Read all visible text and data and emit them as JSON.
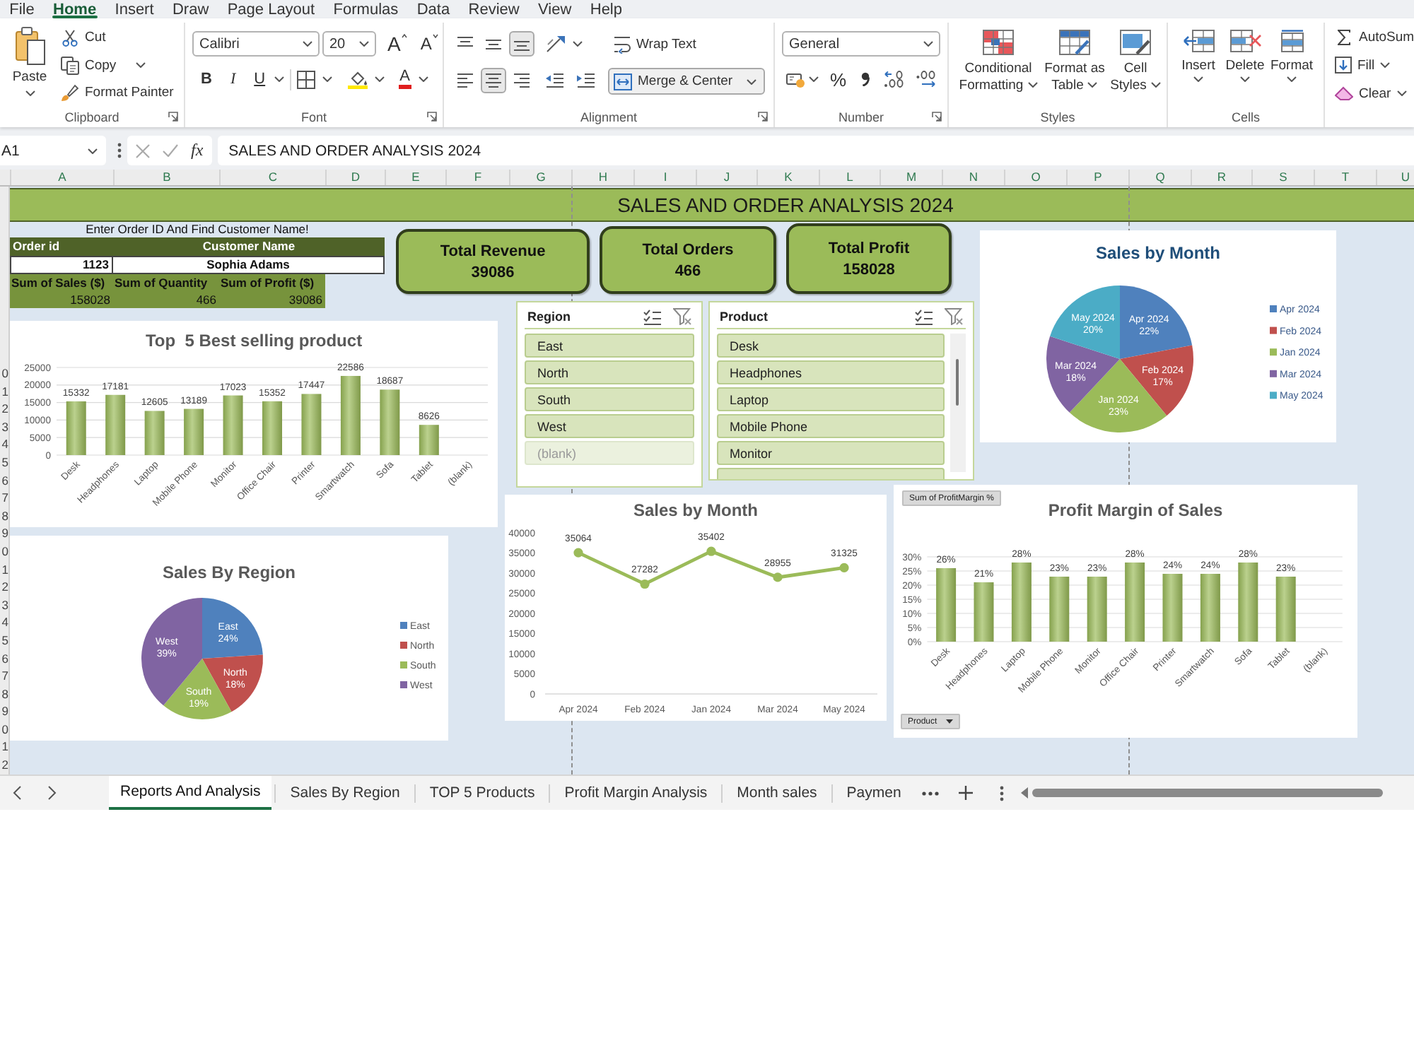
{
  "menu_tabs": [
    {
      "label": "File",
      "selected": false
    },
    {
      "label": "Home",
      "selected": true
    },
    {
      "label": "Insert",
      "selected": false
    },
    {
      "label": "Draw",
      "selected": false
    },
    {
      "label": "Page Layout",
      "selected": false
    },
    {
      "label": "Formulas",
      "selected": false
    },
    {
      "label": "Data",
      "selected": false
    },
    {
      "label": "Review",
      "selected": false
    },
    {
      "label": "View",
      "selected": false
    },
    {
      "label": "Help",
      "selected": false
    }
  ],
  "ribbon": {
    "clipboard": {
      "label": "Clipboard",
      "paste": "Paste",
      "cut": "Cut",
      "copy": "Copy",
      "format_painter": "Format Painter"
    },
    "font": {
      "label": "Font",
      "font_name": "Calibri",
      "font_size": "20",
      "grow": "A",
      "shrink": "A",
      "bold": "B",
      "italic": "I",
      "underline": "U",
      "font_color": "A"
    },
    "alignment": {
      "label": "Alignment",
      "vertical_align": [
        {
          "selected": false
        },
        {
          "selected": false
        },
        {
          "selected": true
        }
      ],
      "horizontal_align": [
        {
          "selected": false
        },
        {
          "selected": true
        },
        {
          "selected": false
        }
      ],
      "wrap_text": {
        "label": "Wrap Text",
        "selected": false
      },
      "merge_center": {
        "label": "Merge & Center",
        "selected": true
      }
    },
    "number": {
      "label": "Number",
      "format": "General",
      "percent": "%"
    },
    "styles": {
      "label": "Styles",
      "buttons": [
        "Conditional Formatting",
        "Format as Table",
        "Cell Styles"
      ]
    },
    "cells": {
      "label": "Cells",
      "buttons": [
        "Insert",
        "Delete",
        "Format"
      ]
    },
    "editing": {
      "buttons": [
        "AutoSum",
        "Fill",
        "Clear"
      ]
    }
  },
  "formula_bar": {
    "name_box": "A1",
    "function_label": "fx",
    "formula": "SALES AND ORDER ANALYSIS 2024"
  },
  "sheet": {
    "columns": [
      "A",
      "B",
      "C",
      "D",
      "E",
      "F",
      "G",
      "H",
      "I",
      "J",
      "K",
      "L",
      "M",
      "N",
      "O",
      "P",
      "Q",
      "R",
      "S",
      "T",
      "U"
    ],
    "row_numbers": [
      "0",
      "1",
      "2",
      "3",
      "4",
      "5",
      "6",
      "7",
      "8",
      "9",
      "0",
      "1",
      "2",
      "3",
      "4",
      "5",
      "6",
      "7",
      "8",
      "9",
      "0",
      "1",
      "2"
    ],
    "title": "SALES AND ORDER ANALYSIS 2024",
    "lookup": {
      "prompt": "Enter Order ID And Find Customer Name!",
      "order_id_header": "Order id",
      "customer_header": "Customer Name",
      "order_id": "1123",
      "customer_name": "Sophia Adams",
      "summary": [
        {
          "header": "Sum of Sales ($)",
          "value": "158028"
        },
        {
          "header": "Sum of Quantity",
          "value": "466"
        },
        {
          "header": "Sum of Profit ($)",
          "value": "39086"
        }
      ]
    },
    "kpis": [
      {
        "label": "Total Revenue",
        "value": "39086"
      },
      {
        "label": "Total Orders",
        "value": "466"
      },
      {
        "label": "Total Profit",
        "value": "158028"
      }
    ],
    "slicers": [
      {
        "title": "Region",
        "items": [
          {
            "label": "East",
            "selected": true,
            "disabled": false
          },
          {
            "label": "North",
            "selected": true,
            "disabled": false
          },
          {
            "label": "South",
            "selected": true,
            "disabled": false
          },
          {
            "label": "West",
            "selected": true,
            "disabled": false
          },
          {
            "label": "(blank)",
            "selected": true,
            "disabled": true
          }
        ]
      },
      {
        "title": "Product",
        "items": [
          {
            "label": "Desk",
            "selected": true,
            "disabled": false
          },
          {
            "label": "Headphones",
            "selected": true,
            "disabled": false
          },
          {
            "label": "Laptop",
            "selected": true,
            "disabled": false
          },
          {
            "label": "Mobile Phone",
            "selected": true,
            "disabled": false
          },
          {
            "label": "Monitor",
            "selected": true,
            "disabled": false
          }
        ]
      }
    ],
    "charts": [
      {
        "chart_data": {
          "type": "pie",
          "title": "Sales by Month",
          "categories": [
            "Apr 2024",
            "Feb 2024",
            "Jan 2024",
            "Mar 2024",
            "May 2024"
          ],
          "values": [
            22,
            17,
            23,
            18,
            20
          ],
          "value_labels": [
            "22%",
            "17%",
            "23%",
            "18%",
            "20%"
          ],
          "colors": [
            "#4f81bd",
            "#c0504d",
            "#9bbb59",
            "#8064a2",
            "#4bacc6"
          ],
          "legend": "right"
        }
      },
      {
        "chart_data": {
          "type": "bar",
          "title": "Top  5 Best selling product",
          "categories": [
            "Desk",
            "Headphones",
            "Laptop",
            "Mobile Phone",
            "Monitor",
            "Office Chair",
            "Printer",
            "Smartwatch",
            "Sofa",
            "Tablet",
            "(blank)"
          ],
          "series": [
            {
              "color": "#9bbb59",
              "values": [
                15332,
                17181,
                12605,
                13189,
                17023,
                15352,
                17447,
                22586,
                18687,
                8626,
                null
              ]
            }
          ],
          "ylim": [
            0,
            25000
          ],
          "yticks": [
            0,
            5000,
            10000,
            15000,
            20000,
            25000
          ],
          "grid": true,
          "data_labels": true
        }
      },
      {
        "chart_data": {
          "type": "line",
          "title": "Sales by Month",
          "categories": [
            "Apr 2024",
            "Feb 2024",
            "Jan 2024",
            "Mar 2024",
            "May 2024"
          ],
          "series": [
            {
              "color": "#9bbb59",
              "marker": true,
              "values": [
                35064,
                27282,
                35402,
                28955,
                31325
              ]
            }
          ],
          "ylim": [
            0,
            40000
          ],
          "yticks": [
            0,
            5000,
            10000,
            15000,
            20000,
            25000,
            30000,
            35000,
            40000
          ],
          "data_labels": true
        }
      },
      {
        "value_field_button": "Sum of ProfitMargin %",
        "axis_field_button": "Product",
        "chart_data": {
          "type": "bar",
          "title": "Profit Margin of Sales",
          "categories": [
            "Desk",
            "Headphones",
            "Laptop",
            "Mobile Phone",
            "Monitor",
            "Office Chair",
            "Printer",
            "Smartwatch",
            "Sofa",
            "Tablet",
            "(blank)"
          ],
          "series": [
            {
              "color": "#9bbb59",
              "values": [
                0.26,
                0.21,
                0.28,
                0.23,
                0.23,
                0.28,
                0.24,
                0.24,
                0.28,
                0.23,
                null
              ]
            }
          ],
          "ylim": [
            0,
            0.3
          ],
          "yticks": [
            {
              "value": 0,
              "label": "0%"
            },
            {
              "value": 0.05,
              "label": "5%"
            },
            {
              "value": 0.1,
              "label": "10%"
            },
            {
              "value": 0.15,
              "label": "15%"
            },
            {
              "value": 0.2,
              "label": "20%"
            },
            {
              "value": 0.25,
              "label": "25%"
            },
            {
              "value": 0.3,
              "label": "30%"
            }
          ],
          "grid": true,
          "value_labels": [
            "26%",
            "21%",
            "28%",
            "23%",
            "23%",
            "28%",
            "24%",
            "24%",
            "28%",
            "23%",
            null
          ]
        }
      },
      {
        "chart_data": {
          "type": "pie",
          "title": "Sales By Region",
          "categories": [
            "East",
            "North",
            "South",
            "West"
          ],
          "values": [
            24,
            18,
            19,
            39
          ],
          "value_labels": [
            "24%",
            "18%",
            "19%",
            "39%"
          ],
          "colors": [
            "#4f81bd",
            "#c0504d",
            "#9bbb59",
            "#8064a2"
          ],
          "legend": "right"
        }
      }
    ]
  },
  "sheet_tabs": [
    {
      "label": "Reports And Analysis",
      "selected": true
    },
    {
      "label": "Sales By Region",
      "selected": false
    },
    {
      "label": "TOP 5 Products",
      "selected": false
    },
    {
      "label": "Profit Margin Analysis",
      "selected": false
    },
    {
      "label": "Month sales",
      "selected": false
    },
    {
      "label": "Paymen",
      "selected": false
    }
  ]
}
